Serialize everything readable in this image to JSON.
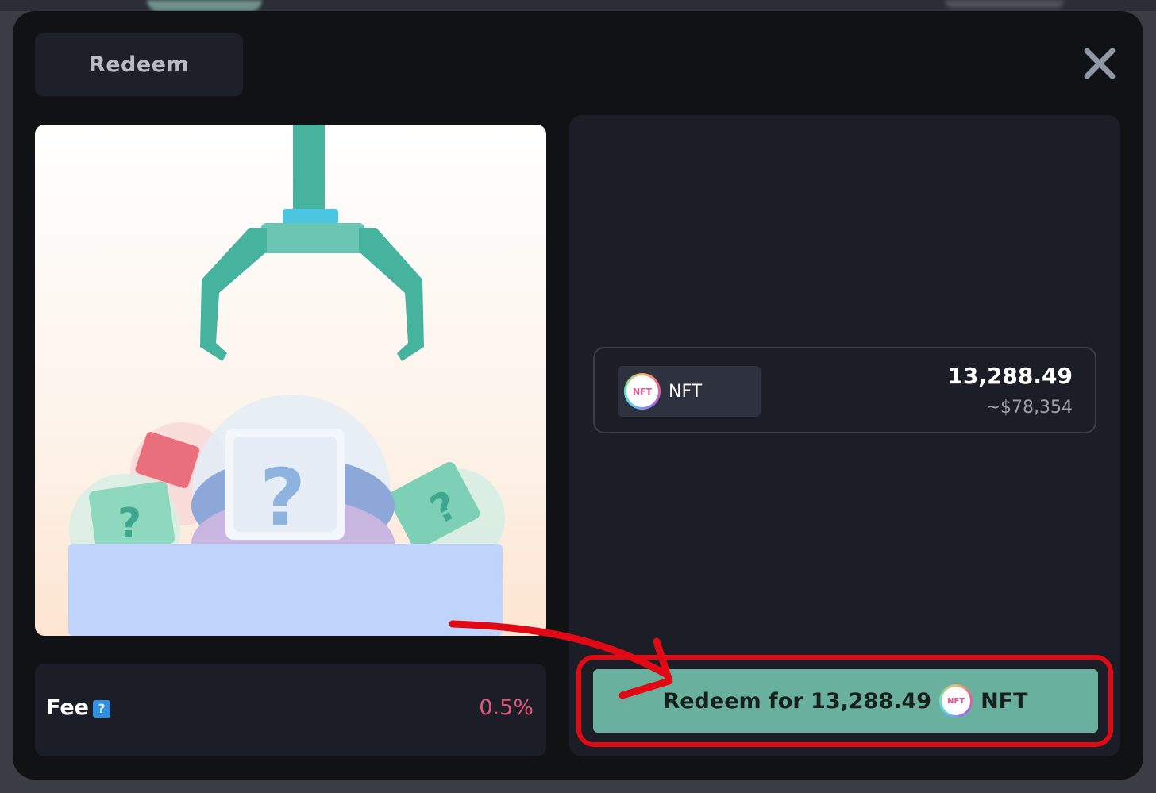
{
  "dialog": {
    "tab_label": "Redeem",
    "close_icon": "close-icon"
  },
  "illustration": {
    "icon": "claw-machine-illustration"
  },
  "fee": {
    "label": "Fee",
    "help_icon": "question-icon",
    "help_glyph": "?",
    "value": "0.5%"
  },
  "token": {
    "logo_icon": "nft-token-icon",
    "logo_text": "NFT",
    "symbol": "NFT",
    "amount": "13,288.49",
    "usd_value": "~$78,354"
  },
  "redeem_button": {
    "prefix": "Redeem for 13,288.49",
    "suffix": "NFT"
  },
  "colors": {
    "accent": "#6ab09f",
    "fee": "#e5577a",
    "annotation": "#e10a14"
  }
}
